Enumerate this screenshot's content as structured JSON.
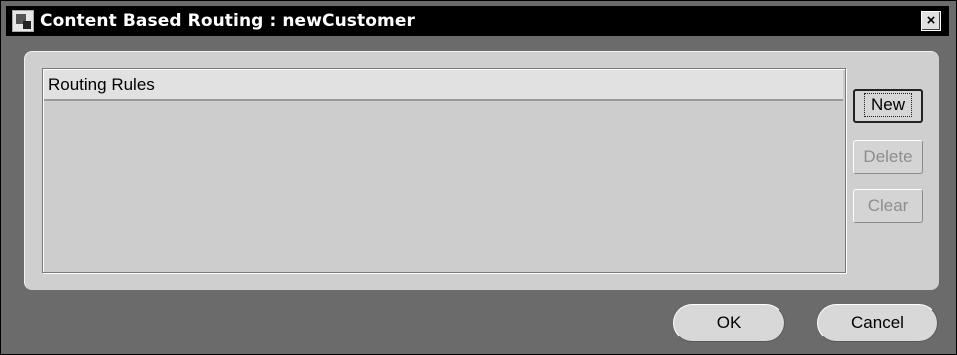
{
  "window": {
    "title": "Content Based Routing : newCustomer",
    "close_label": "×"
  },
  "rules": {
    "header": "Routing Rules",
    "items": []
  },
  "actions": {
    "new_label": "New",
    "delete_label": "Delete",
    "clear_label": "Clear",
    "delete_enabled": false,
    "clear_enabled": false
  },
  "footer": {
    "ok_label": "OK",
    "cancel_label": "Cancel"
  }
}
